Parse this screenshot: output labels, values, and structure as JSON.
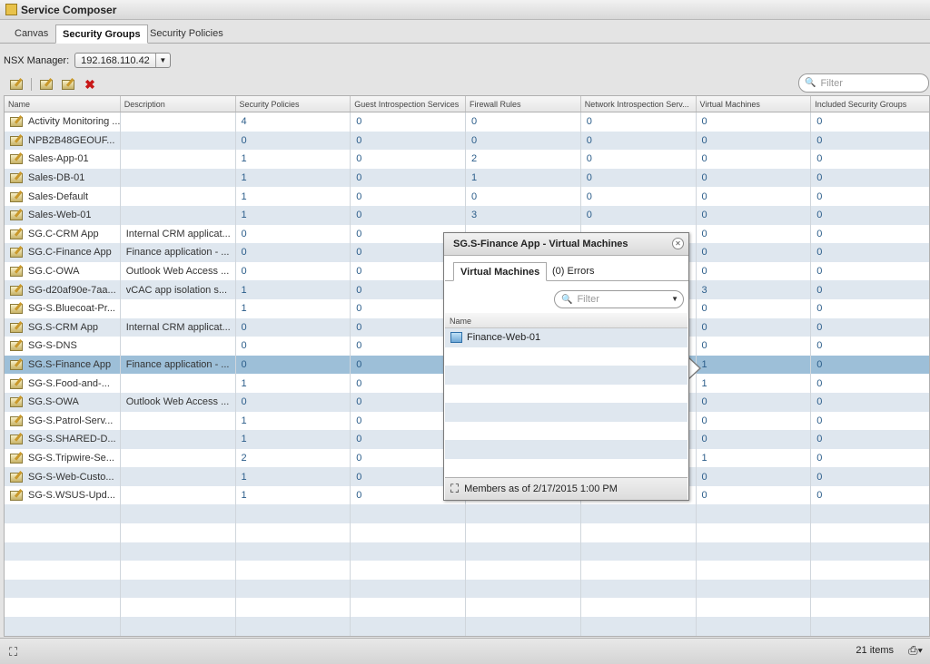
{
  "window": {
    "title": "Service Composer"
  },
  "tabs": [
    {
      "label": "Canvas",
      "active": false
    },
    {
      "label": "Security Groups",
      "active": true
    },
    {
      "label": "Security Policies",
      "active": false
    }
  ],
  "nsx": {
    "label": "NSX Manager:",
    "value": "192.168.110.42"
  },
  "filter": {
    "placeholder": "Filter"
  },
  "columns": [
    "Name",
    "Description",
    "Security Policies",
    "Guest Introspection Services",
    "Firewall Rules",
    "Network Introspection Serv...",
    "Virtual Machines",
    "Included Security Groups"
  ],
  "rows": [
    {
      "name": "Activity Monitoring ...",
      "description": "",
      "policies": "4",
      "guest": "0",
      "firewall": "0",
      "network": "0",
      "vms": "0",
      "included": "0"
    },
    {
      "name": "NPB2B48GEOUF...",
      "description": "",
      "policies": "0",
      "guest": "0",
      "firewall": "0",
      "network": "0",
      "vms": "0",
      "included": "0"
    },
    {
      "name": "Sales-App-01",
      "description": "",
      "policies": "1",
      "guest": "0",
      "firewall": "2",
      "network": "0",
      "vms": "0",
      "included": "0"
    },
    {
      "name": "Sales-DB-01",
      "description": "",
      "policies": "1",
      "guest": "0",
      "firewall": "1",
      "network": "0",
      "vms": "0",
      "included": "0"
    },
    {
      "name": "Sales-Default",
      "description": "",
      "policies": "1",
      "guest": "0",
      "firewall": "0",
      "network": "0",
      "vms": "0",
      "included": "0"
    },
    {
      "name": "Sales-Web-01",
      "description": "",
      "policies": "1",
      "guest": "0",
      "firewall": "3",
      "network": "0",
      "vms": "0",
      "included": "0"
    },
    {
      "name": "SG.C-CRM App",
      "description": "Internal CRM applicat...",
      "policies": "0",
      "guest": "0",
      "firewall": "",
      "network": "",
      "vms": "0",
      "included": "0"
    },
    {
      "name": "SG.C-Finance App",
      "description": "Finance application - ...",
      "policies": "0",
      "guest": "0",
      "firewall": "",
      "network": "",
      "vms": "0",
      "included": "0"
    },
    {
      "name": "SG.C-OWA",
      "description": "Outlook Web Access ...",
      "policies": "0",
      "guest": "0",
      "firewall": "",
      "network": "",
      "vms": "0",
      "included": "0"
    },
    {
      "name": "SG-d20af90e-7aa...",
      "description": "vCAC app isolation s...",
      "policies": "1",
      "guest": "0",
      "firewall": "",
      "network": "",
      "vms": "3",
      "included": "0"
    },
    {
      "name": "SG-S.Bluecoat-Pr...",
      "description": "",
      "policies": "1",
      "guest": "0",
      "firewall": "",
      "network": "",
      "vms": "0",
      "included": "0"
    },
    {
      "name": "SG.S-CRM App",
      "description": "Internal CRM applicat...",
      "policies": "0",
      "guest": "0",
      "firewall": "",
      "network": "",
      "vms": "0",
      "included": "0"
    },
    {
      "name": "SG-S-DNS",
      "description": "",
      "policies": "0",
      "guest": "0",
      "firewall": "",
      "network": "",
      "vms": "0",
      "included": "0"
    },
    {
      "name": "SG.S-Finance App",
      "description": "Finance application - ...",
      "policies": "0",
      "guest": "0",
      "firewall": "",
      "network": "",
      "vms": "1",
      "included": "0",
      "selected": true
    },
    {
      "name": "SG-S.Food-and-...",
      "description": "",
      "policies": "1",
      "guest": "0",
      "firewall": "",
      "network": "",
      "vms": "1",
      "included": "0"
    },
    {
      "name": "SG.S-OWA",
      "description": "Outlook Web Access ...",
      "policies": "0",
      "guest": "0",
      "firewall": "",
      "network": "",
      "vms": "0",
      "included": "0"
    },
    {
      "name": "SG-S.Patrol-Serv...",
      "description": "",
      "policies": "1",
      "guest": "0",
      "firewall": "",
      "network": "",
      "vms": "0",
      "included": "0"
    },
    {
      "name": "SG-S.SHARED-D...",
      "description": "",
      "policies": "1",
      "guest": "0",
      "firewall": "",
      "network": "",
      "vms": "0",
      "included": "0"
    },
    {
      "name": "SG-S.Tripwire-Se...",
      "description": "",
      "policies": "2",
      "guest": "0",
      "firewall": "",
      "network": "",
      "vms": "1",
      "included": "0"
    },
    {
      "name": "SG-S-Web-Custo...",
      "description": "",
      "policies": "1",
      "guest": "0",
      "firewall": "",
      "network": "",
      "vms": "0",
      "included": "0"
    },
    {
      "name": "SG-S.WSUS-Upd...",
      "description": "",
      "policies": "1",
      "guest": "0",
      "firewall": "",
      "network": "",
      "vms": "0",
      "included": "0"
    }
  ],
  "status": {
    "count": "21 items"
  },
  "popup": {
    "title": "SG.S-Finance App - Virtual Machines",
    "tabs": [
      {
        "label": "Virtual Machines",
        "active": true
      },
      {
        "label": "(0) Errors",
        "active": false
      }
    ],
    "filter_placeholder": "Filter",
    "column": "Name",
    "items": [
      "Finance-Web-01"
    ],
    "footer": "Members as of 2/17/2015 1:00 PM"
  }
}
